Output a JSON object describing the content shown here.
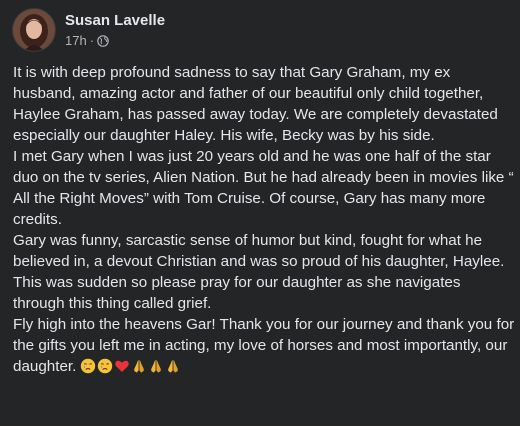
{
  "post": {
    "author": "Susan Lavelle",
    "time": "17h",
    "separator": "·",
    "privacy_icon": "globe-icon",
    "paragraphs": [
      "It is with deep profound sadness to say that Gary Graham, my ex husband, amazing actor and father of our beautiful only child together, Haylee Graham, has passed away today. We are completely devastated especially our daughter Haley. His wife, Becky was by his side.",
      "I met Gary when I was just 20 years old and he was one half of the star duo on the tv series, Alien Nation. But he had already been in movies like “ All the Right Moves” with Tom Cruise. Of course, Gary has many more credits.",
      "Gary was funny, sarcastic sense of humor but kind, fought for what he believed in, a devout Christian and was so proud of his daughter, Haylee.",
      "This was sudden so please pray for our daughter as she navigates through this thing called grief.",
      "Fly high into the heavens Gar! Thank you for our journey and thank you for the gifts you left me in acting, my love of horses and most importantly, our daughter."
    ],
    "emojis": [
      "crying-face-emoji",
      "crying-face-emoji",
      "red-heart-emoji",
      "folded-hands-emoji",
      "folded-hands-emoji",
      "folded-hands-emoji"
    ]
  },
  "colors": {
    "background": "#242526",
    "primary_text": "#e4e6eb",
    "secondary_text": "#b0b3b8"
  }
}
